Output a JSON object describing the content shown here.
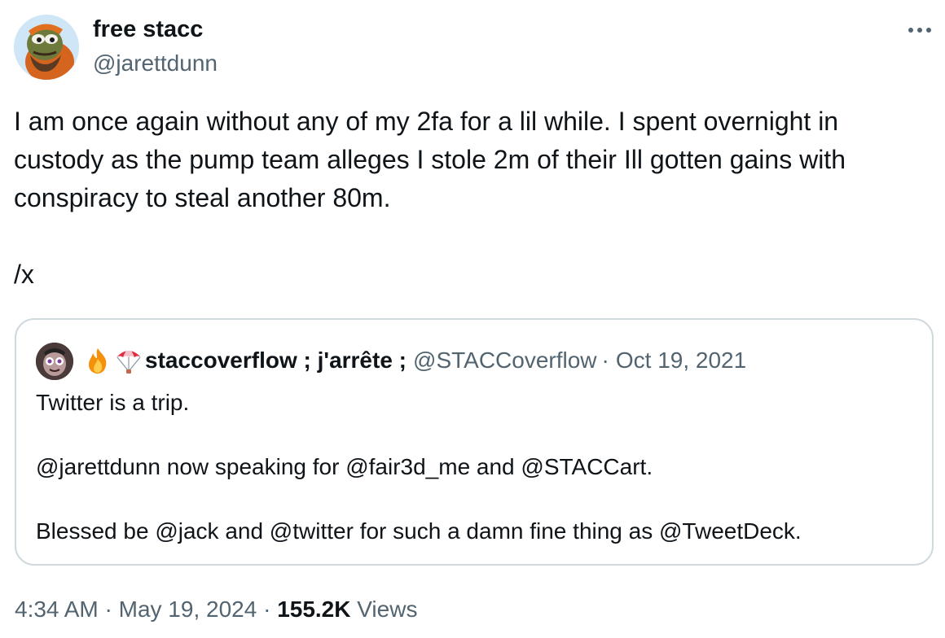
{
  "author": {
    "display_name": "free stacc",
    "handle": "@jarettdunn",
    "avatar_icon": "pepe-avatar-icon",
    "more_icon": "more-horizontal-icon"
  },
  "tweet": {
    "lines": [
      "I am once again without any of my 2fa for a lil while. I spent overnight in custody as the pump team alleges I stole 2m of their Ill gotten gains with conspiracy to steal another 80m.",
      "/x"
    ]
  },
  "quoted": {
    "emoji_1": "fire-emoji-icon",
    "emoji_2": "parachute-emoji-icon",
    "display_name": "staccoverflow ; j'arrête ;",
    "handle": "@STACCoverflow",
    "separator": "·",
    "date": "Oct 19, 2021",
    "lines": [
      "Twitter is a trip.",
      "@jarettdunn now speaking for @fair3d_me and @STACCart.",
      "Blessed be @jack and @twitter for such a damn fine thing as @TweetDeck."
    ]
  },
  "meta": {
    "time": "4:34 AM",
    "separator": "·",
    "date": "May 19, 2024",
    "views_count": "155.2K",
    "views_label": "Views"
  },
  "colors": {
    "text": "#0f1419",
    "secondary": "#536471",
    "border": "#cfd9de"
  }
}
